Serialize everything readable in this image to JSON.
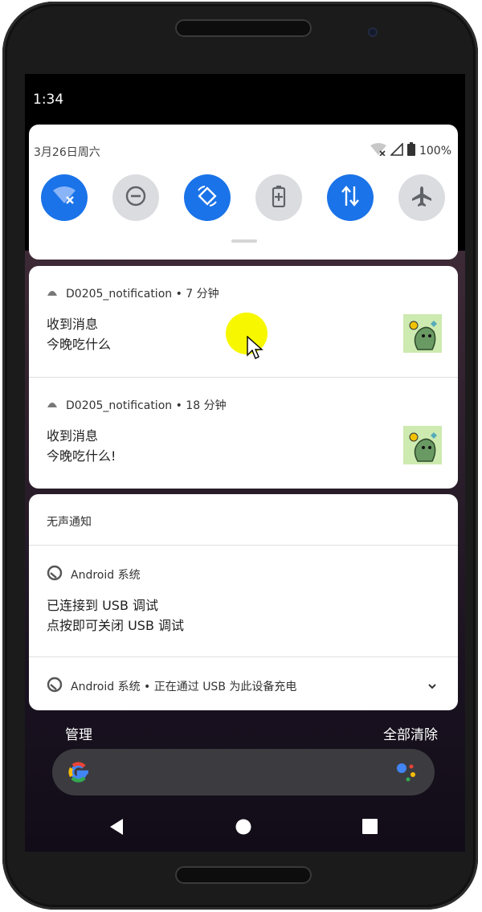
{
  "status_bar": {
    "time": "1:34"
  },
  "quick_settings": {
    "date": "3月26日周六",
    "battery": "100%",
    "tiles": [
      {
        "name": "wifi-tile",
        "icon": "wifi-off-icon",
        "state": "on"
      },
      {
        "name": "dnd-tile",
        "icon": "do-not-disturb-icon",
        "state": "off"
      },
      {
        "name": "auto-rotate-tile",
        "icon": "auto-rotate-icon",
        "state": "on"
      },
      {
        "name": "battery-saver-tile",
        "icon": "battery-saver-icon",
        "state": "off"
      },
      {
        "name": "mobile-data-tile",
        "icon": "data-transfer-icon",
        "state": "on"
      },
      {
        "name": "airplane-mode-tile",
        "icon": "airplane-icon",
        "state": "off"
      }
    ]
  },
  "notifications": [
    {
      "app": "D0205_notification",
      "time": "• 7 分钟",
      "title": "收到消息",
      "text": "今晚吃什么"
    },
    {
      "app": "D0205_notification",
      "time": "• 18 分钟",
      "title": "收到消息",
      "text": "今晚吃什么!"
    }
  ],
  "silent_section": {
    "label": "无声通知",
    "items": [
      {
        "app": "Android 系统",
        "title": "已连接到 USB 调试",
        "text": "点按即可关闭 USB 调试"
      },
      {
        "app": "Android 系统",
        "summary": "• 正在通过 USB 为此设备充电"
      }
    ]
  },
  "footer": {
    "manage": "管理",
    "clear_all": "全部清除"
  },
  "colors": {
    "accent": "#1a73e8",
    "tile_off": "#dadce0",
    "cursor": "#f7f700"
  }
}
